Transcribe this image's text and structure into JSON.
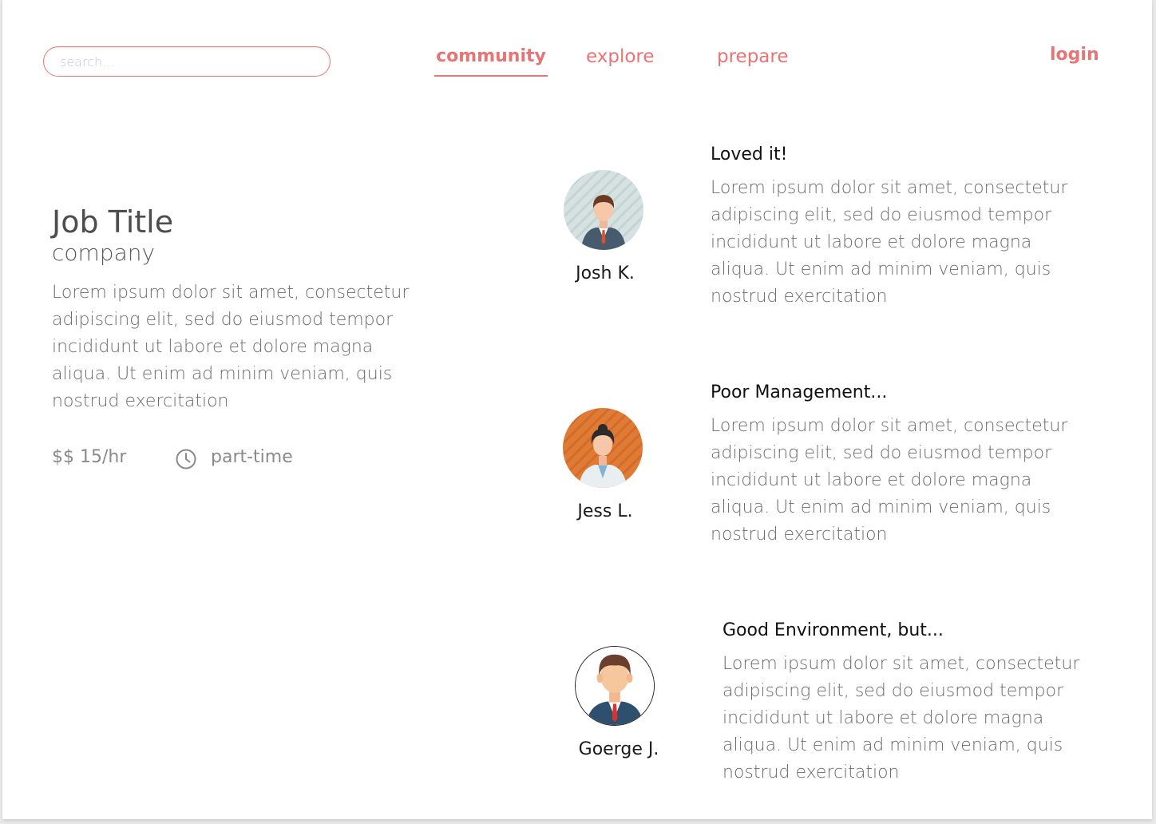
{
  "search": {
    "placeholder": "search..."
  },
  "nav": {
    "items": [
      {
        "label": "community",
        "active": true
      },
      {
        "label": "explore",
        "active": false
      },
      {
        "label": "prepare",
        "active": false
      }
    ],
    "login": "login"
  },
  "colors": {
    "accent": "#e87575",
    "text_muted": "#6b6b6b"
  },
  "job": {
    "title": "Job Title",
    "company": "company",
    "description": "Lorem ipsum dolor sit amet, consectetur adipiscing elit, sed do eiusmod tempor incididunt ut labore et dolore magna aliqua. Ut enim ad minim veniam, quis nostrud exercitation",
    "pay": "$$ 15/hr",
    "type_icon": "clock-icon",
    "type": "part-time"
  },
  "reviews": [
    {
      "name": "Josh K.",
      "title": "Loved it!",
      "body": "Lorem ipsum dolor sit amet, consectetur adipiscing elit, sed do eiusmod tempor incididunt ut labore et dolore magna aliqua. Ut enim ad minim veniam, quis nostrud exercitation",
      "avatar_icon": "businessman-avatar-icon"
    },
    {
      "name": "Jess L.",
      "title": "Poor Management...",
      "body": "Lorem ipsum dolor sit amet, consectetur adipiscing elit, sed do eiusmod tempor incididunt ut labore et dolore magna aliqua. Ut enim ad minim veniam, quis nostrud exercitation",
      "avatar_icon": "doctor-avatar-icon"
    },
    {
      "name": "Goerge J.",
      "title": "Good Environment, but...",
      "body": "Lorem ipsum dolor sit amet, consectetur adipiscing elit, sed do eiusmod tempor incididunt ut labore et dolore magna aliqua. Ut enim ad minim veniam, quis nostrud exercitation",
      "avatar_icon": "man-avatar-icon"
    }
  ]
}
